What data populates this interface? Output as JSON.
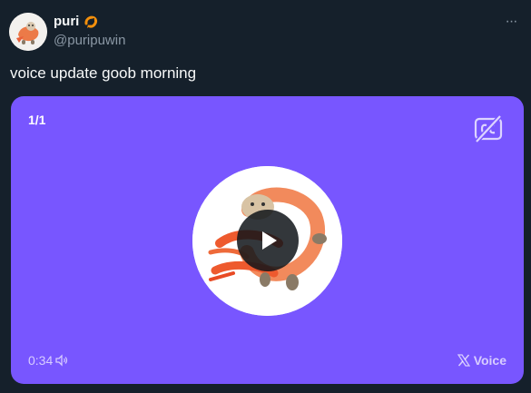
{
  "author": {
    "display_name": "puri",
    "handle": "@puripuwin",
    "avatar_icon": "shrimp-avatar",
    "badge_icon": "shrimp-emoji-icon"
  },
  "tweet": {
    "text": "voice update goob morning",
    "more_icon": "more-options-icon",
    "more_label": "···"
  },
  "voice_card": {
    "counter": "1/1",
    "duration": "0:34",
    "source_label": "Voice",
    "cc_icon": "captions-off-icon",
    "play_icon": "play-icon",
    "volume_icon": "speaker-icon",
    "brand_icon": "x-logo-icon",
    "background_color": "#7856ff"
  }
}
